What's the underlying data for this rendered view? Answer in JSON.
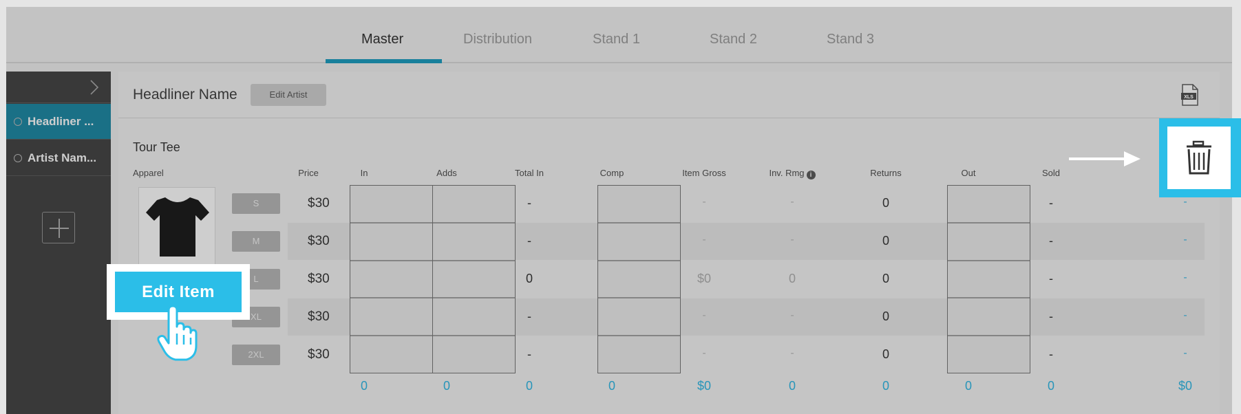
{
  "tabs": [
    {
      "label": "Master",
      "active": true
    },
    {
      "label": "Distribution",
      "active": false
    },
    {
      "label": "Stand 1",
      "active": false
    },
    {
      "label": "Stand 2",
      "active": false
    },
    {
      "label": "Stand 3",
      "active": false
    }
  ],
  "sidebar": {
    "items": [
      {
        "label": "Headliner ...",
        "active": true
      },
      {
        "label": "Artist Nam...",
        "active": false
      }
    ],
    "add_icon": "plus-icon",
    "toggle_icon": "chevron-right-icon"
  },
  "header": {
    "artist_name": "Headliner Name",
    "edit_artist_label": "Edit Artist",
    "export_icon": "xls-file-icon"
  },
  "item": {
    "name": "Tour Tee",
    "category": "Apparel",
    "image": "black-tshirt"
  },
  "columns": {
    "apparel": "Apparel",
    "price": "Price",
    "in": "In",
    "adds": "Adds",
    "total_in": "Total In",
    "comp": "Comp",
    "item_gross": "Item Gross",
    "inv_rmg": "Inv. Rmg",
    "info": "i",
    "returns": "Returns",
    "out": "Out",
    "sold": "Sold"
  },
  "rows": [
    {
      "size": "S",
      "price": "$30",
      "total_in": "-",
      "item_gross": "-",
      "inv_rmg": "-",
      "returns": "0",
      "sold": "-",
      "net": "-"
    },
    {
      "size": "M",
      "price": "$30",
      "total_in": "-",
      "item_gross": "-",
      "inv_rmg": "-",
      "returns": "0",
      "sold": "-",
      "net": "-"
    },
    {
      "size": "L",
      "price": "$30",
      "total_in": "0",
      "item_gross": "$0",
      "inv_rmg": "0",
      "returns": "0",
      "sold": "-",
      "net": "-"
    },
    {
      "size": "XL",
      "price": "$30",
      "total_in": "-",
      "item_gross": "-",
      "inv_rmg": "-",
      "returns": "0",
      "sold": "-",
      "net": "-"
    },
    {
      "size": "2XL",
      "price": "$30",
      "total_in": "-",
      "item_gross": "-",
      "inv_rmg": "-",
      "returns": "0",
      "sold": "-",
      "net": "-"
    }
  ],
  "totals": {
    "in": "0",
    "adds": "0",
    "total_in": "0",
    "comp": "0",
    "item_gross": "$0",
    "inv_rmg": "0",
    "returns": "0",
    "out": "0",
    "sold": "0",
    "net": "$0"
  },
  "callouts": {
    "edit_item_label": "Edit Item",
    "pointer_icon": "hand-pointer-icon",
    "delete_icon": "trash-icon",
    "arrow_icon": "arrow-right-icon"
  },
  "colors": {
    "accent": "#2bbee8",
    "tab_underline": "#1c8fae",
    "sidebar_active": "#1e7d96",
    "total_blue": "#2da6cf"
  }
}
